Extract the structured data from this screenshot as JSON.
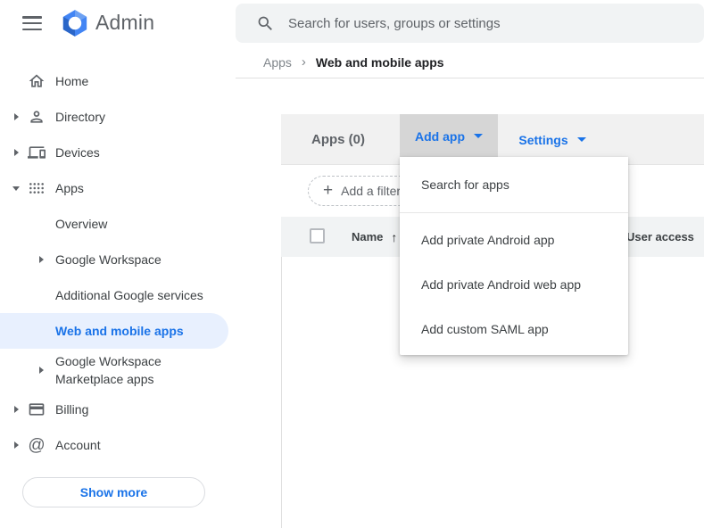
{
  "colors": {
    "accent": "#1a73e8",
    "selected_bg": "#e8f0fe",
    "toolbar_bg": "#f1f1f1",
    "pressed_button_bg": "#d6d6d6",
    "table_header_bg": "#f1f3f4"
  },
  "icons": {
    "add": "+",
    "sort_ascending": "↑",
    "breadcrumb_separator": "›",
    "at_sign": "@"
  },
  "topbar": {
    "brand": "Admin",
    "search_placeholder": "Search for users, groups or settings"
  },
  "breadcrumb": {
    "parent": "Apps",
    "current": "Web and mobile apps"
  },
  "sidebar": {
    "nav": [
      {
        "label": "Home",
        "icon": "home-icon",
        "expandable": false
      },
      {
        "label": "Directory",
        "icon": "person-icon",
        "expandable": true
      },
      {
        "label": "Devices",
        "icon": "devices-icon",
        "expandable": true
      },
      {
        "label": "Apps",
        "icon": "apps-grid-icon",
        "expandable": true,
        "expanded": true
      },
      {
        "label": "Overview",
        "parent": "Apps"
      },
      {
        "label": "Google Workspace",
        "parent": "Apps",
        "expandable": true
      },
      {
        "label": "Additional Google services",
        "parent": "Apps"
      },
      {
        "label": "Web and mobile apps",
        "parent": "Apps",
        "selected": true
      },
      {
        "label": "Google Workspace Marketplace apps",
        "parent": "Apps",
        "expandable": true
      },
      {
        "label": "Billing",
        "icon": "billing-icon",
        "expandable": true
      },
      {
        "label": "Account",
        "icon": "at-icon",
        "expandable": true
      }
    ],
    "show_more_label": "Show more"
  },
  "toolbar": {
    "title": "Apps (0)",
    "add_app_label": "Add app",
    "settings_label": "Settings"
  },
  "filter": {
    "chip_label": "Add a filter"
  },
  "table": {
    "columns": [
      "Name",
      "User access"
    ],
    "sort_column": "Name",
    "sort_direction": "ascending",
    "row_count": 0
  },
  "menu": {
    "items": [
      "Search for apps",
      "Add private Android app",
      "Add private Android web app",
      "Add custom SAML app"
    ]
  }
}
